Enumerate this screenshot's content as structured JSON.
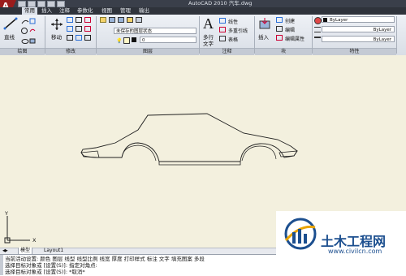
{
  "app": {
    "title": "AutoCAD 2010   汽车.dwg",
    "menu_icon": "autocad-logo-icon"
  },
  "tabs": [
    "常用",
    "插入",
    "注释",
    "参数化",
    "视图",
    "管理",
    "输出"
  ],
  "ribbon": {
    "draw": {
      "title": "绘图",
      "line": "直线"
    },
    "modify": {
      "title": "修改",
      "move": "移动"
    },
    "layers": {
      "title": "图层",
      "layer_state": "未保存的图层状态",
      "current_layer": "0"
    },
    "annotation": {
      "title": "注释",
      "multiline_text": "多行",
      "text": "文字",
      "linear": "线性",
      "multileader": "多重引线",
      "table": "表格"
    },
    "block": {
      "title": "块",
      "insert": "插入",
      "create": "创建",
      "edit": "编辑",
      "edit_attributes": "编辑属性"
    },
    "properties": {
      "title": "特性",
      "color": "ByLayer",
      "linetype": "ByLayer",
      "lineweight": "ByLayer"
    }
  },
  "layout_tabs": [
    "模型",
    "Layout1"
  ],
  "ucs": {
    "x": "X",
    "y": "Y"
  },
  "command": {
    "line1": "当前活动设置: 颜色 图层 线型 线型比例 线宽 厚度 打印样式 标注 文字 填充图案 多段",
    "line2": "选择目标对象或 [设置(S)]: 指定对角点:",
    "line3": "选择目标对象或 [设置(S)]: *取消*"
  },
  "watermark": {
    "title": "土木工程网",
    "url": "www.civilcn.com"
  }
}
